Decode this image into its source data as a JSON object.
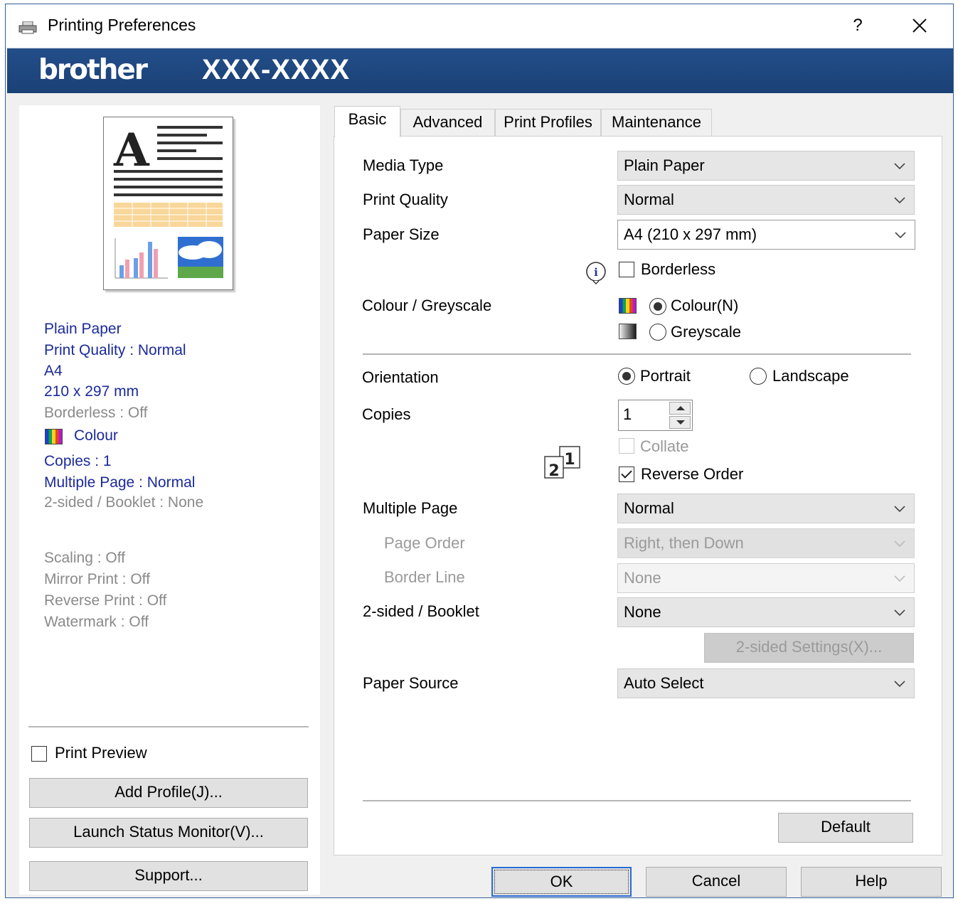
{
  "window": {
    "title": "Printing Preferences",
    "help_label": "?",
    "close_label": "✕"
  },
  "banner": {
    "brand": "brother",
    "model": "XXX-XXXX"
  },
  "summary": {
    "media": "Plain Paper",
    "print_quality": "Print Quality : Normal",
    "paper": "A4",
    "dimensions": "210 x 297 mm",
    "borderless": "Borderless : Off",
    "colour": "Colour",
    "copies": "Copies : 1",
    "multiple_page": "Multiple Page : Normal",
    "two_sided": "2-sided / Booklet : None",
    "scaling": "Scaling : Off",
    "mirror": "Mirror Print : Off",
    "reverse": "Reverse Print : Off",
    "watermark": "Watermark : Off"
  },
  "left_controls": {
    "print_preview": "Print Preview",
    "add_profile": "Add Profile(J)...",
    "launch_status_monitor": "Launch Status Monitor(V)...",
    "support": "Support..."
  },
  "tabs": [
    "Basic",
    "Advanced",
    "Print Profiles",
    "Maintenance"
  ],
  "basic": {
    "media_type_label": "Media Type",
    "media_type_value": "Plain Paper",
    "print_quality_label": "Print Quality",
    "print_quality_value": "Normal",
    "paper_size_label": "Paper Size",
    "paper_size_value": "A4 (210 x 297 mm)",
    "borderless_label": "Borderless",
    "colour_greyscale_label": "Colour / Greyscale",
    "colour_option": "Colour(N)",
    "greyscale_option": "Greyscale",
    "orientation_label": "Orientation",
    "portrait_option": "Portrait",
    "landscape_option": "Landscape",
    "copies_label": "Copies",
    "copies_value": "1",
    "collate_label": "Collate",
    "reverse_order_label": "Reverse Order",
    "multiple_page_label": "Multiple Page",
    "multiple_page_value": "Normal",
    "page_order_label": "Page Order",
    "page_order_value": "Right, then Down",
    "border_line_label": "Border Line",
    "border_line_value": "None",
    "two_sided_label": "2-sided / Booklet",
    "two_sided_value": "None",
    "two_sided_settings": "2-sided Settings(X)...",
    "paper_source_label": "Paper Source",
    "paper_source_value": "Auto Select",
    "default_button": "Default",
    "order_icon_front": "1",
    "order_icon_back": "2"
  },
  "footer": {
    "ok": "OK",
    "cancel": "Cancel",
    "help": "Help"
  },
  "state": {
    "borderless_checked": false,
    "colour_selected": true,
    "portrait_selected": true,
    "collate_checked": false,
    "collate_enabled": false,
    "reverse_order_checked": true,
    "print_preview_checked": false
  },
  "colors": {
    "banner": "#1b4176",
    "summary_text": "#1b2a9a",
    "disabled_text": "#8a8a8a",
    "focus_border": "#2a6cd6"
  },
  "icons": {
    "title": "printer-icon",
    "info": "info-icon",
    "dropdown": "chevron-down-icon",
    "colour": "colour-swatch-icon",
    "greyscale": "greyscale-swatch-icon"
  }
}
